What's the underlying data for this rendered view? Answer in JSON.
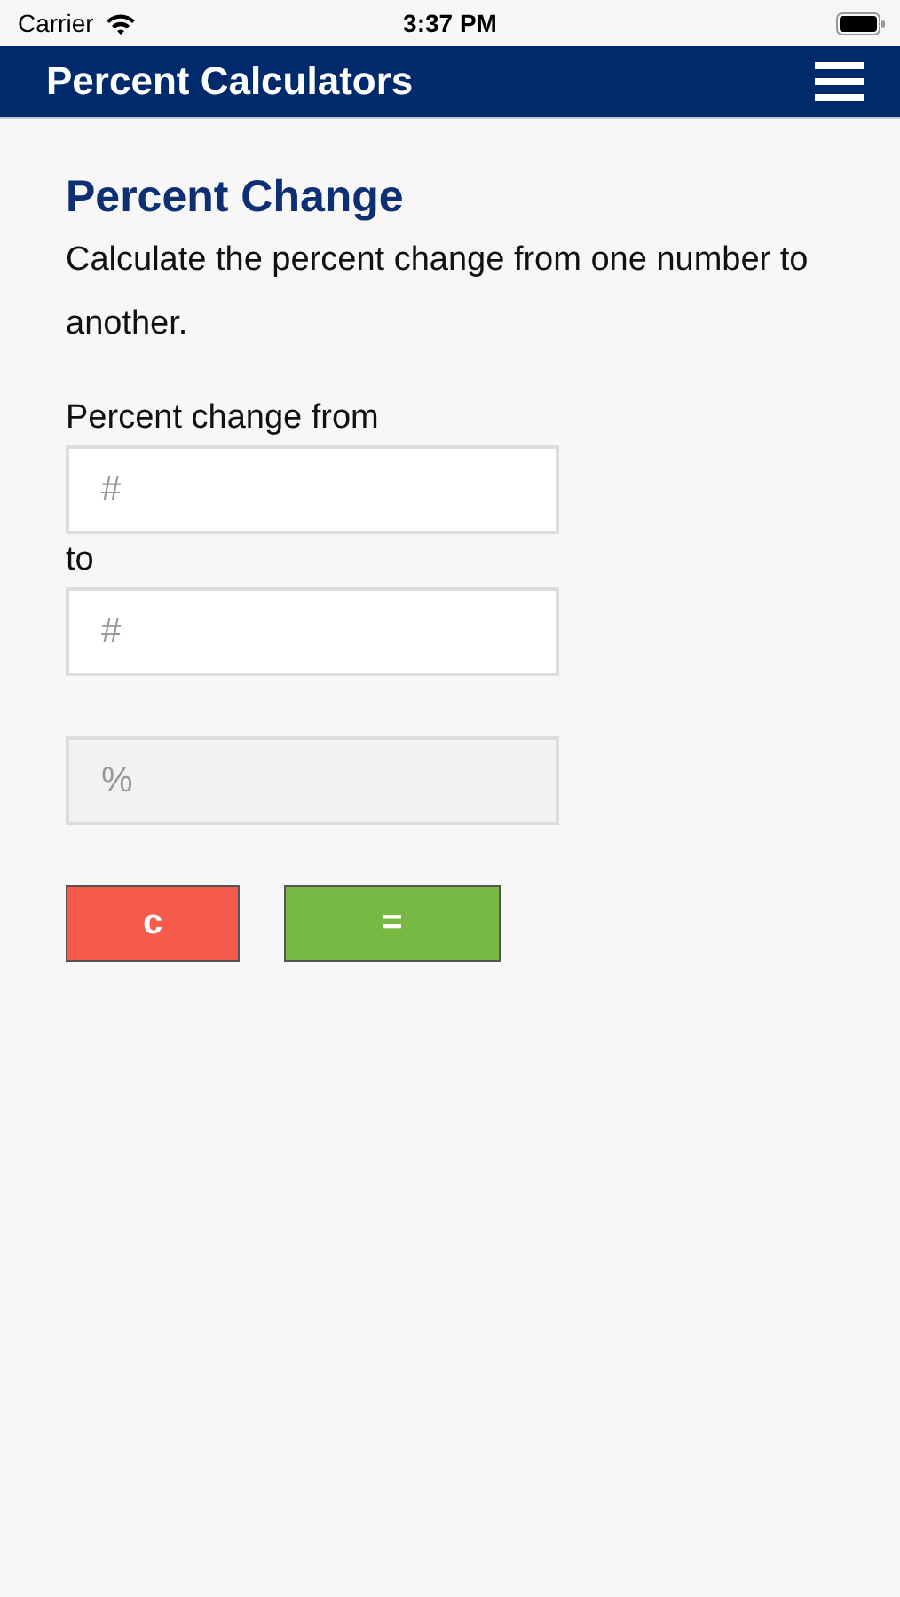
{
  "status_bar": {
    "carrier": "Carrier",
    "time": "3:37 PM"
  },
  "header": {
    "title": "Percent Calculators"
  },
  "calculator": {
    "title": "Percent Change",
    "description": "Calculate the percent change from one number to another.",
    "fields": [
      {
        "label": "Percent change from",
        "placeholder": "#",
        "disabled": false
      },
      {
        "label": "to",
        "placeholder": "#",
        "disabled": false
      },
      {
        "placeholder": "%",
        "disabled": true
      }
    ],
    "buttons": [
      {
        "label": "c",
        "color": "#f65a4a"
      },
      {
        "label": "=",
        "color": "#78b943"
      }
    ]
  }
}
